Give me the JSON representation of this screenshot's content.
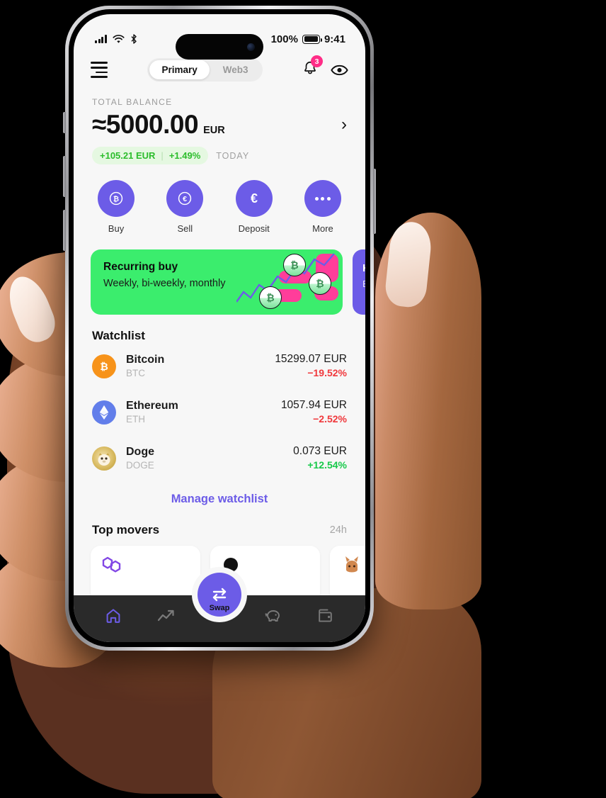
{
  "status_bar": {
    "signal_icon": "cellular-bars-icon",
    "wifi_icon": "wifi-icon",
    "bluetooth_icon": "bluetooth-icon",
    "battery_percent": "100%",
    "battery_icon": "battery-full-icon",
    "time": "9:41"
  },
  "header": {
    "menu_icon": "hamburger-menu-icon",
    "segments": [
      {
        "label": "Primary",
        "active": true
      },
      {
        "label": "Web3",
        "active": false
      }
    ],
    "bell_icon": "bell-icon",
    "notification_count": "3",
    "eye_icon": "eye-icon"
  },
  "balance": {
    "label": "TOTAL BALANCE",
    "amount": "≈5000.00",
    "currency": "EUR",
    "chevron_icon": "chevron-right-icon",
    "change_value": "+105.21 EUR",
    "change_separator": "|",
    "change_percent": "+1.49%",
    "period": "TODAY",
    "change_color": "#2bbd2b",
    "pill_bg": "#e5f8e1"
  },
  "actions": [
    {
      "label": "Buy",
      "icon": "bitcoin-circle-icon",
      "glyph": "₿"
    },
    {
      "label": "Sell",
      "icon": "euro-circle-icon",
      "glyph": "€"
    },
    {
      "label": "Deposit",
      "icon": "euro-icon",
      "glyph": "€"
    },
    {
      "label": "More",
      "icon": "ellipsis-icon",
      "glyph": "…"
    }
  ],
  "promos": [
    {
      "title": "Recurring buy",
      "subtitle": "Weekly, bi-weekly, monthly",
      "bg": "#3bed6d",
      "accent": "#ff3d9a"
    },
    {
      "title": "K",
      "subtitle": "E",
      "bg": "#6c5ce7"
    }
  ],
  "watchlist": {
    "title": "Watchlist",
    "items": [
      {
        "name": "Bitcoin",
        "symbol": "BTC",
        "price": "15299.07 EUR",
        "change": "−19.52%",
        "direction": "down",
        "icon": "bitcoin-icon",
        "icon_color": "#f7931a",
        "glyph": "₿"
      },
      {
        "name": "Ethereum",
        "symbol": "ETH",
        "price": "1057.94 EUR",
        "change": "−2.52%",
        "direction": "down",
        "icon": "ethereum-icon",
        "icon_color": "#627eea",
        "glyph": "◆"
      },
      {
        "name": "Doge",
        "symbol": "DOGE",
        "price": "0.073 EUR",
        "change": "+12.54%",
        "direction": "up",
        "icon": "dogecoin-icon",
        "icon_color": "#c3a634",
        "glyph": "Ð"
      }
    ],
    "manage_label": "Manage watchlist",
    "manage_color": "#6c5ce7"
  },
  "top_movers": {
    "title": "Top movers",
    "timeframe": "24h",
    "cards": [
      {
        "icon": "polygon-icon",
        "color": "#8247e5"
      },
      {
        "icon": "coin-icon",
        "color": "#111111"
      },
      {
        "icon": "pancakeswap-rabbit-icon",
        "color": "#d1884f"
      }
    ]
  },
  "bottom_nav": {
    "items": [
      {
        "icon": "home-icon",
        "active": true
      },
      {
        "icon": "trending-up-icon",
        "active": false
      },
      {
        "icon": "piggy-bank-icon",
        "active": false
      },
      {
        "icon": "wallet-icon",
        "active": false
      }
    ],
    "fab": {
      "icon": "swap-arrows-icon",
      "label": "Swap"
    },
    "active_color": "#6c5ce7",
    "bg": "#2a2a2a"
  }
}
